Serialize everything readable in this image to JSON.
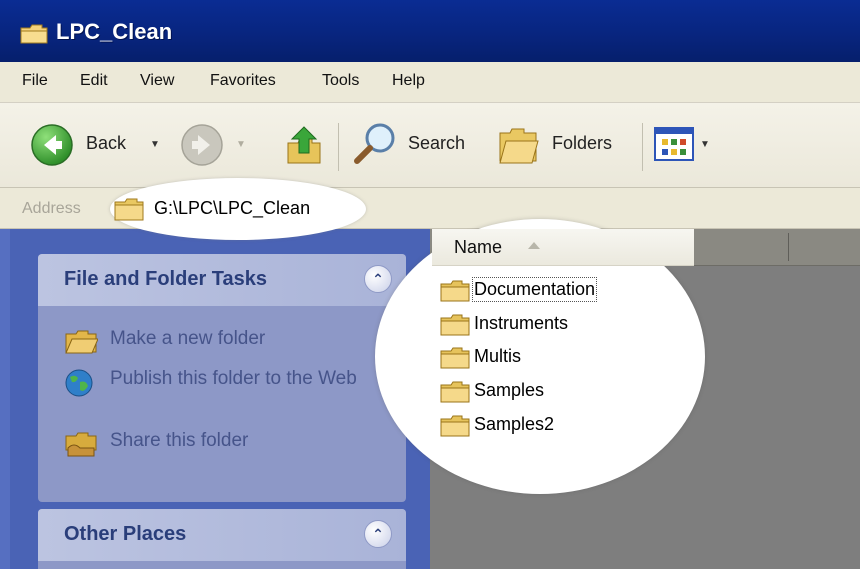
{
  "window": {
    "title": "LPC_Clean"
  },
  "menu": {
    "items": [
      {
        "label": "File"
      },
      {
        "label": "Edit"
      },
      {
        "label": "View"
      },
      {
        "label": "Favorites"
      },
      {
        "label": "Tools"
      },
      {
        "label": "Help"
      }
    ]
  },
  "toolbar": {
    "back_label": "Back",
    "search_label": "Search",
    "folders_label": "Folders"
  },
  "address": {
    "label": "Address",
    "path": "G:\\LPC\\LPC_Clean"
  },
  "task_pane": {
    "file_folder_tasks": {
      "title": "File and Folder Tasks",
      "items": [
        {
          "label": "Make a new folder",
          "icon": "new-folder-icon"
        },
        {
          "label": "Publish this folder to the Web",
          "icon": "globe-icon"
        },
        {
          "label": "Share this folder",
          "icon": "share-folder-icon"
        }
      ]
    },
    "other_places": {
      "title": "Other Places"
    }
  },
  "file_list": {
    "columns": [
      {
        "label": "Name",
        "sort": "ascending"
      }
    ],
    "items": [
      {
        "name": "Documentation",
        "selected": true
      },
      {
        "name": "Instruments",
        "selected": false
      },
      {
        "name": "Multis",
        "selected": false
      },
      {
        "name": "Samples",
        "selected": false
      },
      {
        "name": "Samples2",
        "selected": false
      }
    ]
  },
  "colors": {
    "title_bar": "#0a2c93",
    "task_pane": "#4a63b5",
    "folder": "#f5d27a"
  }
}
